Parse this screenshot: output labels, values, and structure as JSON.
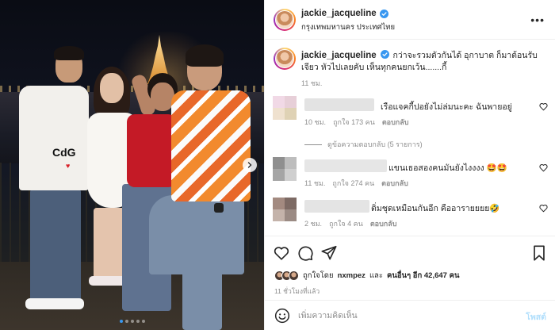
{
  "post": {
    "username": "jackie_jacqueline",
    "location": "กรุงเทพมหานคร ประเทศไทย",
    "more_icon": "more-horizontal-icon",
    "photo": {
      "cdg_text": "CdG",
      "slide_count": 5,
      "active_slide": 1
    }
  },
  "caption": {
    "username": "jackie_jacqueline",
    "text": "กว่าจะรวมตัวกันได้ อุกาบาต ก็มาต้อนรับ เจียว หัวไปเลยคับ เห็นทุกคนยกเว้น.......กี้",
    "time": "11 ชม."
  },
  "comments": [
    {
      "text": "เรือแจคกี้ปอยังไม่ล่มนะคะ ฉันพายอยู่",
      "time": "10 ชม.",
      "likes": "ถูกใจ 173 คน",
      "reply_label": "ตอบกลับ",
      "avatar_colors": [
        "#f1d9e6",
        "#e7cfd8",
        "#efe1cf",
        "#dfd2b5"
      ],
      "name_color": "#e3e3e3"
    },
    {
      "text": "แขนเธอสองคนมันยังไงงงง 🤩🤩",
      "time": "11 ชม.",
      "likes": "ถูกใจ 274 คน",
      "reply_label": "ตอบกลับ",
      "avatar_colors": [
        "#8f8f8f",
        "#bdbdbd",
        "#a5a5a5",
        "#cfcfcf"
      ],
      "name_color": "#e6e6e6"
    },
    {
      "text": "ติ่มชุดเหมือนกันอีก คืออารายยยย🤣",
      "time": "2 ชม.",
      "likes": "ถูกใจ 4 คน",
      "reply_label": "ตอบกลับ",
      "avatar_colors": [
        "#a38a80",
        "#7d6a64",
        "#c4b3aa",
        "#9b8b84"
      ],
      "name_color": "#e4e4e4"
    }
  ],
  "view_replies": "ดูข้อความตอบกลับ (5 รายการ)",
  "actions": {
    "icons": [
      "heart-icon",
      "comment-icon",
      "share-icon",
      "bookmark-icon"
    ],
    "likes_prefix": "ถูกใจโดย",
    "likes_user": "nxmpez",
    "likes_middle": "และ",
    "likes_others": "คนอื่นๆ อีก 42,647 คน",
    "post_time": "11 ชั่วโมงที่แล้ว"
  },
  "add_comment": {
    "placeholder": "เพิ่มความคิดเห็น",
    "post_label": "โพสต์",
    "emoji_icon": "emoji-smile-icon"
  },
  "colors": {
    "accent": "#0095f6",
    "verified": "#3897f0",
    "post_btn_disabled": "#b2dffc",
    "muted": "#8e8e8e"
  }
}
